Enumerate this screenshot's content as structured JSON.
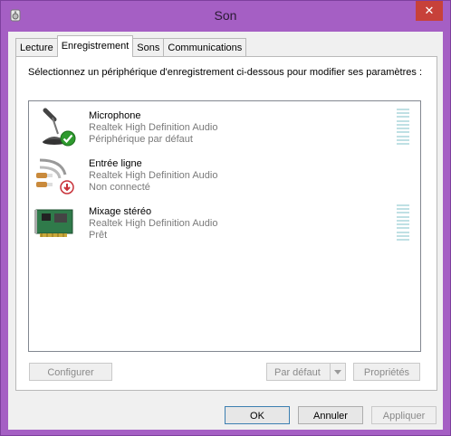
{
  "window": {
    "title": "Son",
    "close_glyph": "✕",
    "icon": "speaker-icon"
  },
  "tabs": [
    {
      "label": "Lecture",
      "active": false
    },
    {
      "label": "Enregistrement",
      "active": true
    },
    {
      "label": "Sons",
      "active": false
    },
    {
      "label": "Communications",
      "active": false
    }
  ],
  "panel": {
    "instruction": "Sélectionnez un périphérique d'enregistrement ci-dessous pour modifier ses paramètres :",
    "devices": [
      {
        "name": "Microphone",
        "driver": "Realtek High Definition Audio",
        "status": "Périphérique par défaut",
        "icon": "microphone-icon",
        "badge": "default-check-icon",
        "level_meter": true
      },
      {
        "name": "Entrée ligne",
        "driver": "Realtek High Definition Audio",
        "status": "Non connecté",
        "icon": "line-in-cable-icon",
        "badge": "unplugged-icon",
        "level_meter": false
      },
      {
        "name": "Mixage stéréo",
        "driver": "Realtek High Definition Audio",
        "status": "Prêt",
        "icon": "sound-card-icon",
        "badge": "",
        "level_meter": true
      }
    ],
    "buttons": {
      "configure": "Configurer",
      "set_default": "Par défaut",
      "properties": "Propriétés"
    }
  },
  "footer": {
    "ok": "OK",
    "cancel": "Annuler",
    "apply": "Appliquer"
  },
  "colors": {
    "frame": "#a55fc4",
    "close": "#c7413a",
    "level_meter": "#bfe0e4",
    "check_badge": "#2e9a2e",
    "unplugged_badge": "#c8323a"
  }
}
